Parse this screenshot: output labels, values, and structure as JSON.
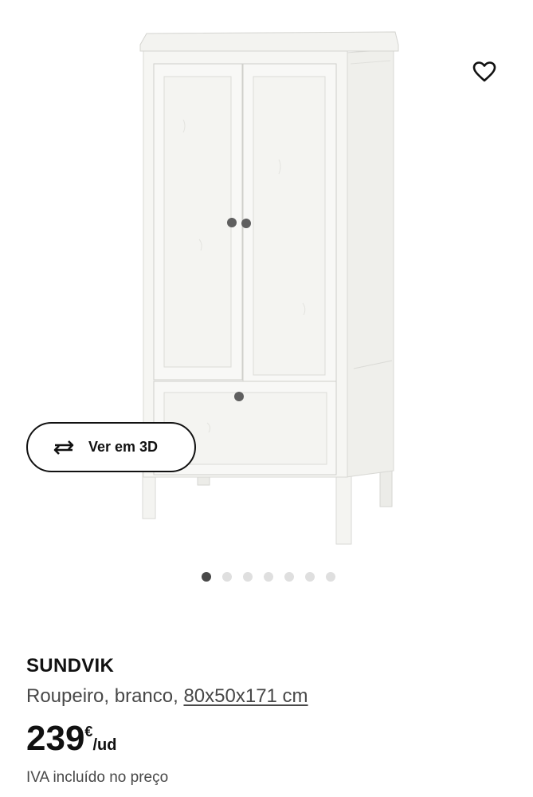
{
  "product": {
    "name": "SUNDVIK",
    "description_prefix": "Roupeiro, branco, ",
    "dimensions": "80x50x171 cm",
    "price_amount": "239",
    "price_currency": "€",
    "price_unit": "/ud",
    "vat_note": "IVA incluído no preço"
  },
  "gallery": {
    "view3d_label": "Ver em 3D",
    "dot_count": 7,
    "active_index": 0
  },
  "icons": {
    "favorite": "heart-icon",
    "view3d": "rotate-3d-icon"
  },
  "colors": {
    "text": "#111111",
    "secondary_text": "#484848",
    "dot_active": "#484848",
    "dot_inactive": "#dfdfdf"
  }
}
